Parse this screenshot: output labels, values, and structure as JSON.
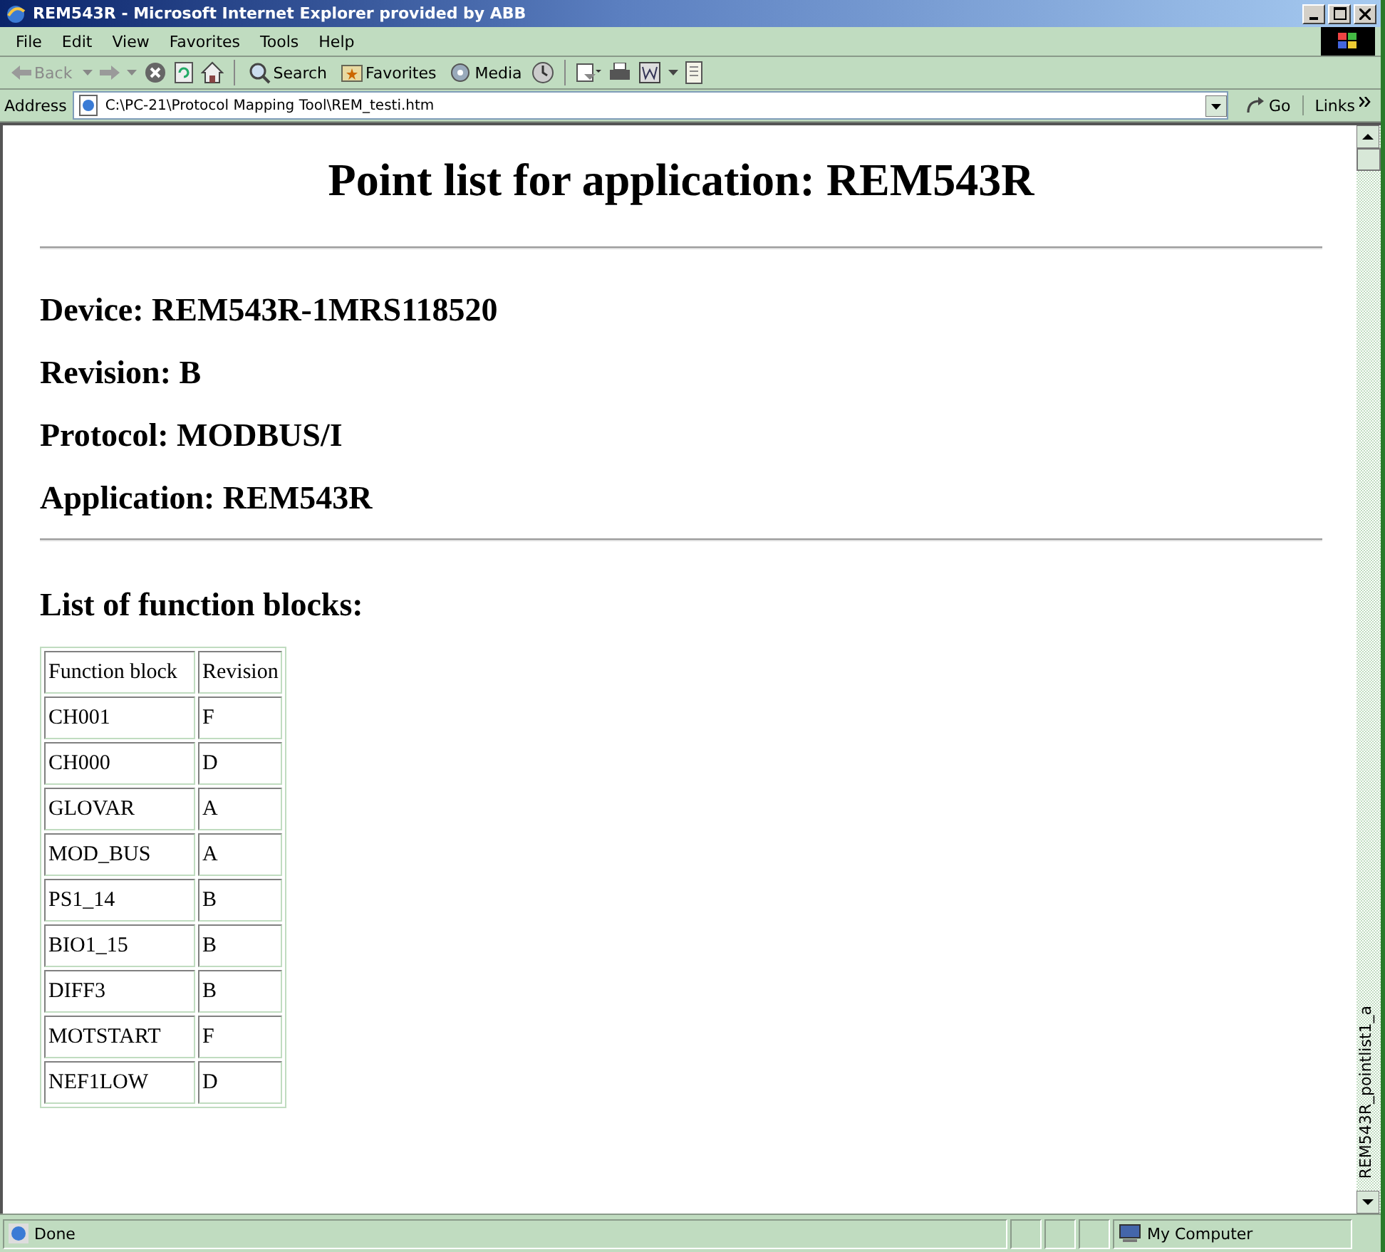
{
  "window": {
    "title": "REM543R - Microsoft Internet Explorer provided by ABB"
  },
  "menu": [
    "File",
    "Edit",
    "View",
    "Favorites",
    "Tools",
    "Help"
  ],
  "toolbar": {
    "back": {
      "label": "Back",
      "disabled": true
    },
    "search": "Search",
    "favorites": "Favorites",
    "media": "Media"
  },
  "address": {
    "label": "Address",
    "value": "C:\\PC-21\\Protocol Mapping Tool\\REM_testi.htm",
    "go": "Go",
    "links": "Links"
  },
  "page": {
    "title": "Point list for application: REM543R",
    "info": [
      "Device: REM543R-1MRS118520",
      "Revision: B",
      "Protocol: MODBUS/I",
      "Application: REM543R"
    ],
    "section": "List of function blocks:",
    "table": {
      "columns": [
        "Function block",
        "Revision"
      ],
      "rows": [
        [
          "CH001",
          "F"
        ],
        [
          "CH000",
          "D"
        ],
        [
          "GLOVAR",
          "A"
        ],
        [
          "MOD_BUS",
          "A"
        ],
        [
          "PS1_14",
          "B"
        ],
        [
          "BIO1_15",
          "B"
        ],
        [
          "DIFF3",
          "B"
        ],
        [
          "MOTSTART",
          "F"
        ],
        [
          "NEF1LOW",
          "D"
        ]
      ]
    }
  },
  "side_label": "REM543R_pointlist1_a",
  "status_bar": {
    "text": "Done",
    "zone": "My Computer"
  }
}
